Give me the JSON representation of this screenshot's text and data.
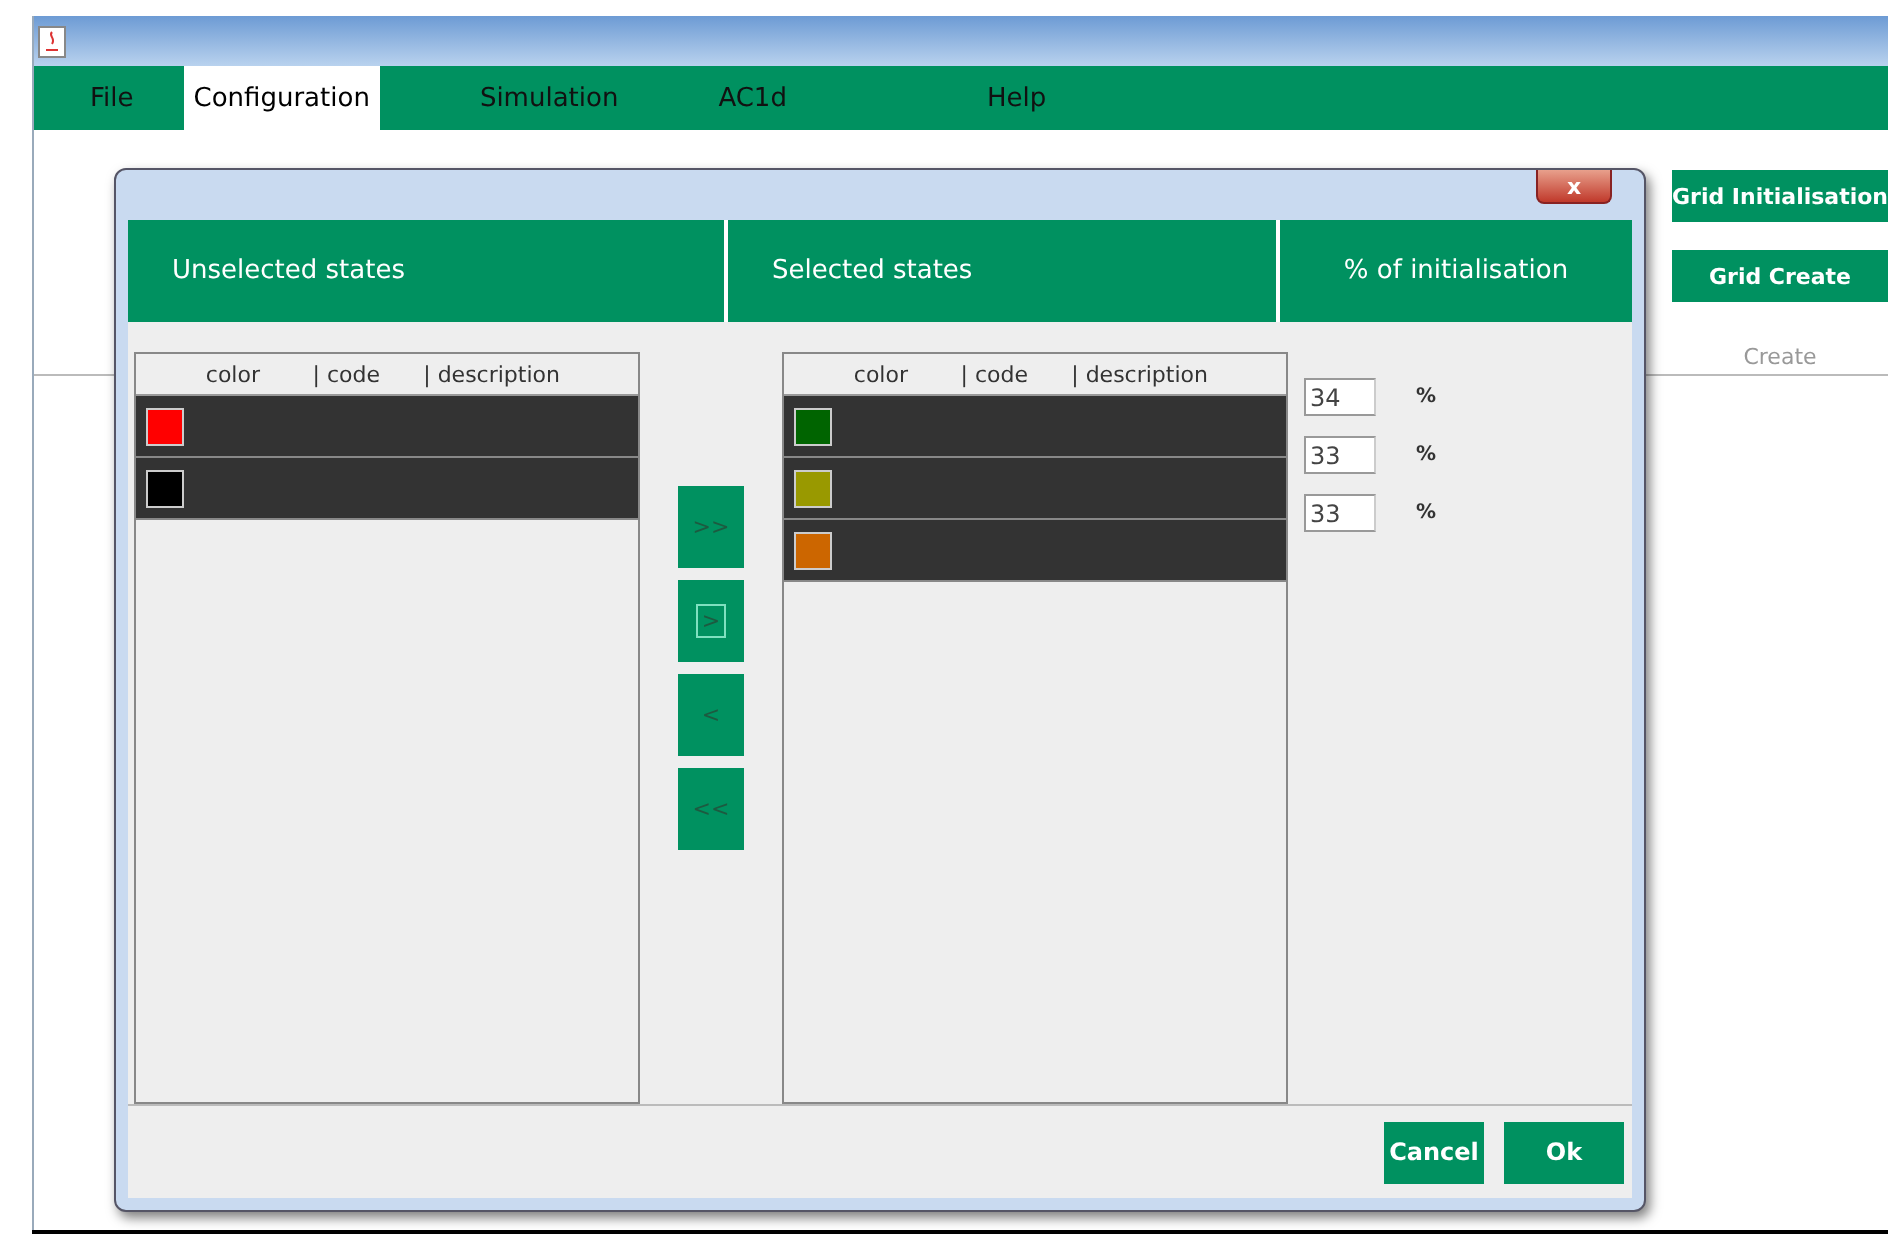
{
  "menu": [
    {
      "label": "File",
      "selected": false
    },
    {
      "label": "Configuration",
      "selected": true
    },
    {
      "label": "Simulation",
      "selected": false
    },
    {
      "label": "AC1d",
      "selected": false
    },
    {
      "label": "Help",
      "selected": false
    }
  ],
  "side_buttons": [
    {
      "label": "Grid Initialisation",
      "disabled": false
    },
    {
      "label": "Grid Create",
      "disabled": false
    },
    {
      "label": "Create",
      "disabled": true
    }
  ],
  "dialog": {
    "close": "x",
    "headers": [
      "Unselected states",
      "Selected states",
      "% of initialisation"
    ],
    "unselected": {
      "columns": [
        "color",
        "| code",
        "| description"
      ],
      "rows": [
        {
          "color": "#ff0000"
        },
        {
          "color": "#000000"
        }
      ]
    },
    "selected": {
      "columns": [
        "color",
        "| code",
        "| description"
      ],
      "rows": [
        {
          "color": "#006400"
        },
        {
          "color": "#999900"
        },
        {
          "color": "#cc6600"
        }
      ]
    },
    "transfer_buttons": [
      {
        "label": ">>",
        "focused": false
      },
      {
        "label": ">",
        "focused": true
      },
      {
        "label": "<",
        "focused": false
      },
      {
        "label": "<<",
        "focused": false
      }
    ],
    "percentages": [
      {
        "value": "34",
        "unit": "%"
      },
      {
        "value": "33",
        "unit": "%"
      },
      {
        "value": "33",
        "unit": "%"
      }
    ],
    "buttons": [
      "Cancel",
      "Ok"
    ]
  }
}
